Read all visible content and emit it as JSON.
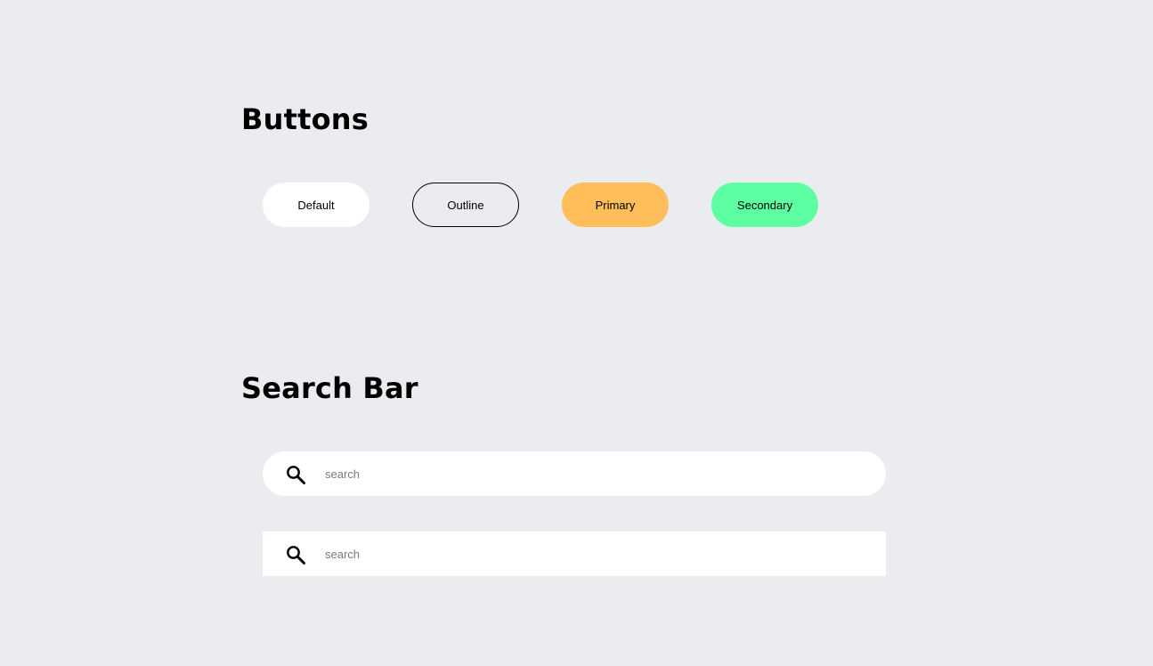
{
  "sections": {
    "buttons": {
      "title": "Buttons",
      "items": [
        {
          "label": "Default"
        },
        {
          "label": "Outline"
        },
        {
          "label": "Primary"
        },
        {
          "label": "Secondary"
        }
      ]
    },
    "search_bar": {
      "title": "Search Bar",
      "bars": [
        {
          "placeholder": "search",
          "style": "rounded"
        },
        {
          "placeholder": "search",
          "style": "square"
        }
      ]
    }
  },
  "icons": {
    "search": "search-icon"
  },
  "colors": {
    "background": "#ebecf0",
    "default_button": "#ffffff",
    "primary_button": "#ffbe5a",
    "secondary_button": "#5effa2",
    "outline_border": "#000000",
    "placeholder_text": "#7a7a7a"
  }
}
